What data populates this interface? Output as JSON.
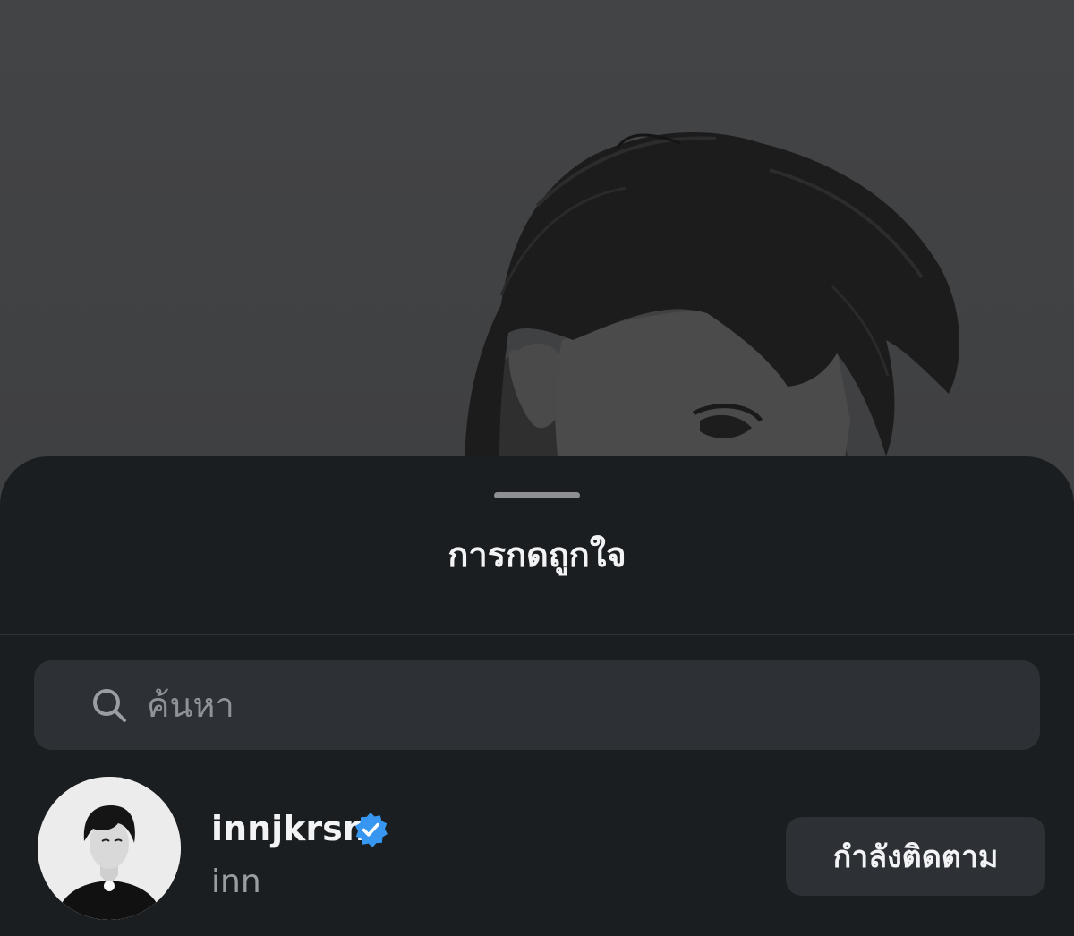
{
  "sheet": {
    "title": "การกดถูกใจ"
  },
  "search": {
    "placeholder": "ค้นหา",
    "value": ""
  },
  "likes": [
    {
      "username": "innjkrsn",
      "full_name": "inn",
      "verified": true,
      "follow_label": "กำลังติดตาม"
    }
  ],
  "colors": {
    "sheet_bg": "#1b1e21",
    "field_bg": "#2d3136",
    "verified_badge": "#3797f0",
    "text_primary": "#f2f3f5",
    "text_secondary": "#9a9ea3"
  },
  "icons": [
    "search-icon",
    "verified-badge-icon"
  ]
}
